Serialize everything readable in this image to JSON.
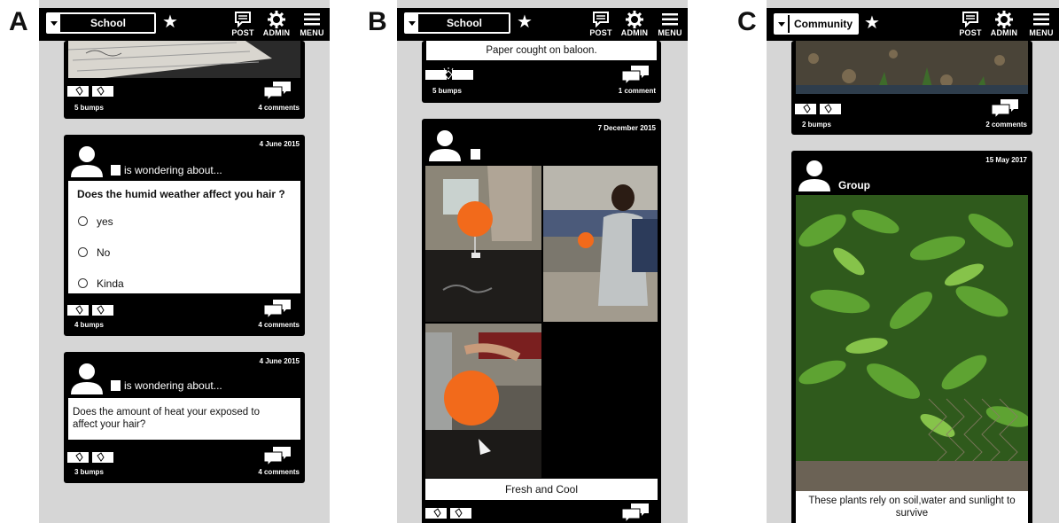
{
  "figure_labels": [
    "A",
    "B",
    "C"
  ],
  "toolbar": {
    "post": "POST",
    "admin": "ADMIN",
    "menu": "MENU",
    "star": "★"
  },
  "panel_a": {
    "group": "School",
    "card1": {
      "bumps": "5 bumps",
      "comments": "4 comments"
    },
    "card2": {
      "date": "4 June 2015",
      "wondering": "is wondering about...",
      "question": "Does the humid weather affect you hair ?",
      "options": [
        "yes",
        "No",
        "Kinda"
      ],
      "bumps": "4 bumps",
      "comments": "4 comments"
    },
    "card3": {
      "date": "4 June 2015",
      "wondering": "is wondering about...",
      "text": "Does the amount of heat your exposed to affect your hair?",
      "bumps": "3 bumps",
      "comments": "4 comments"
    }
  },
  "panel_b": {
    "group": "School",
    "card1": {
      "caption": "Paper cought on baloon.",
      "bumps": "5 bumps",
      "comments": "1 comment"
    },
    "card2": {
      "date": "7 December 2015",
      "caption": "Fresh and Cool"
    }
  },
  "panel_c": {
    "group": "Community",
    "card1": {
      "bumps": "2 bumps",
      "comments": "2 comments"
    },
    "card2": {
      "date": "15 May 2017",
      "author": "Group",
      "caption": "These plants rely on soil,water and sunlight to survive"
    }
  },
  "colors": {
    "frame": "#d6d6d6",
    "card": "#000000",
    "balloon": "#f26a1b",
    "foliage": "#4e8f2a"
  },
  "icons": [
    "chevron-down-icon",
    "star-icon",
    "post-icon",
    "gear-icon",
    "menu-icon",
    "avatar-icon",
    "bump-icon",
    "comment-icon",
    "radio-icon"
  ]
}
